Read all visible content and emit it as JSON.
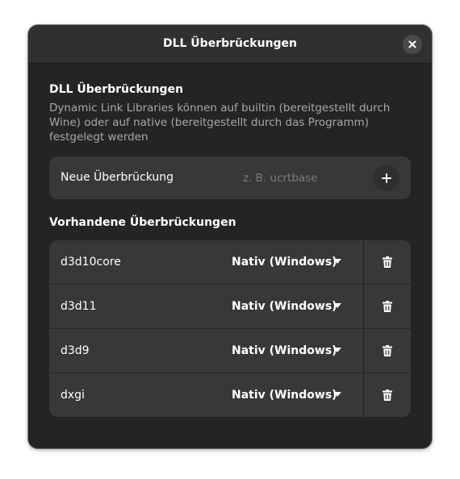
{
  "window": {
    "title": "DLL Überbrückungen"
  },
  "intro": {
    "heading": "DLL Überbrückungen",
    "description": "Dynamic Link Libraries können auf builtin (bereitgestellt durch Wine) oder auf native (bereitgestellt durch das Programm) festgelegt werden"
  },
  "new_override": {
    "label": "Neue Überbrückung",
    "placeholder": "z. B. ucrtbase",
    "value": ""
  },
  "existing": {
    "heading": "Vorhandene Überbrückungen",
    "items": [
      {
        "name": "d3d10core",
        "mode": "Nativ (Windows)"
      },
      {
        "name": "d3d11",
        "mode": "Nativ (Windows)"
      },
      {
        "name": "d3d9",
        "mode": "Nativ (Windows)"
      },
      {
        "name": "dxgi",
        "mode": "Nativ (Windows)"
      }
    ]
  },
  "icons": {
    "close": "close-icon",
    "add": "plus-icon",
    "dropdown": "chevron-down-icon",
    "delete": "trash-icon"
  },
  "colors": {
    "window_bg": "#242424",
    "headerbar_bg": "#303030",
    "card_bg": "#383838",
    "text": "#ffffff",
    "dim_text": "#a8a8a8"
  }
}
